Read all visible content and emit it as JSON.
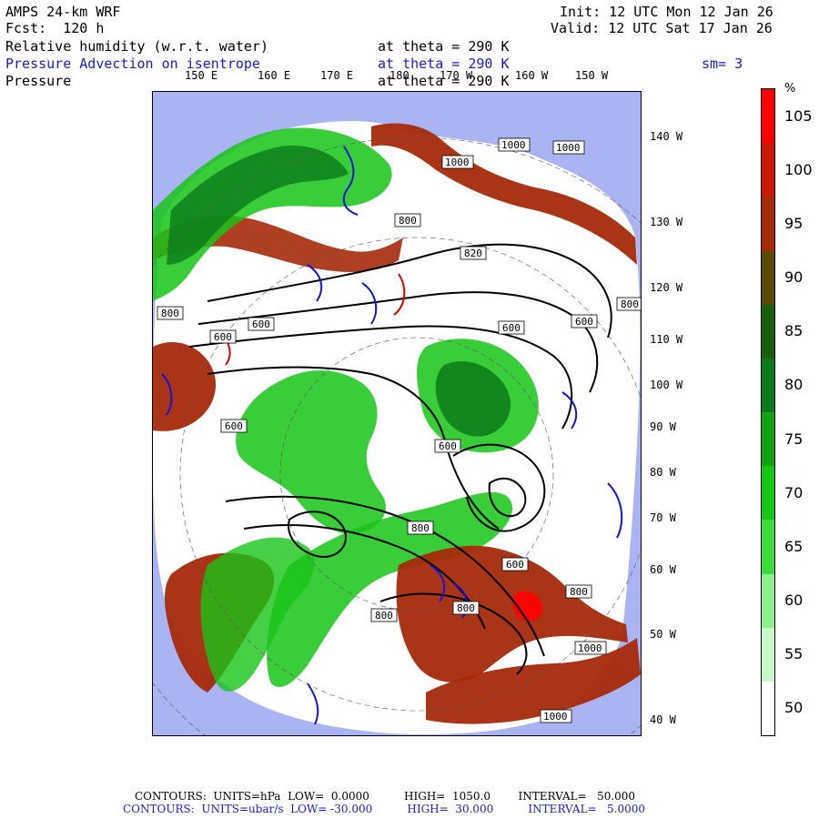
{
  "header": {
    "model": "AMPS 24-km WRF",
    "forecast": "Fcst:  120 h",
    "init": "Init: 12 UTC Mon 12 Jan 26",
    "valid": "Valid: 12 UTC Sat 17 Jan 26",
    "field1": "Relative humidity (w.r.t. water)",
    "field2": "Pressure Advection on isentrope",
    "field3": "Pressure",
    "theta1": "at theta = 290 K",
    "theta2": "at theta = 290 K",
    "theta3": "at theta = 290 K",
    "smoothing": "sm= 3"
  },
  "map": {
    "lon_top": [
      "150 E",
      "160 E",
      "170 E",
      "180",
      "170 W",
      "160 W",
      "150 W"
    ],
    "lon_right": [
      "140 W",
      "130 W",
      "120 W",
      "110 W",
      "100 W",
      "90 W",
      "80 W",
      "70 W",
      "60 W",
      "50 W",
      "40 W"
    ],
    "pressure_labels": [
      "1000",
      "1000",
      "1000",
      "800",
      "820",
      "800",
      "600",
      "600",
      "600",
      "800",
      "600",
      "600",
      "600",
      "800",
      "800",
      "600",
      "800",
      "1000",
      "1000",
      "820",
      "800"
    ],
    "colors": {
      "ocean": "#aab4f2",
      "ice": "#ffffff",
      "dark_red": "#a52a0a",
      "red": "#e81e0a",
      "dark_green": "#0a7a1a",
      "green": "#18c418",
      "light_green": "#86ef7e",
      "contour_black": "#000000",
      "contour_blue": "#1414d4",
      "contour_red": "#e00000"
    }
  },
  "colorbar": {
    "unit": "%",
    "labels": [
      "105",
      "100",
      "95",
      "90",
      "85",
      "80",
      "75",
      "70",
      "65",
      "60",
      "55",
      "50"
    ],
    "colors": [
      "#ff0000",
      "#cc1800",
      "#a52a0a",
      "#5c4a00",
      "#1a5c10",
      "#0a7a1a",
      "#12a312",
      "#14c814",
      "#3bdc3b",
      "#8cf08c",
      "#c8f8c8",
      "#ffffff"
    ]
  },
  "footer": {
    "line1": "CONTOURS:  UNITS=hPa  LOW=  0.0000          HIGH=  1050.0        INTERVAL=   50.000",
    "line2": "CONTOURS:  UNITS=ubar/s  LOW= -30.000          HIGH=  30.000          INTERVAL=   5.0000"
  }
}
